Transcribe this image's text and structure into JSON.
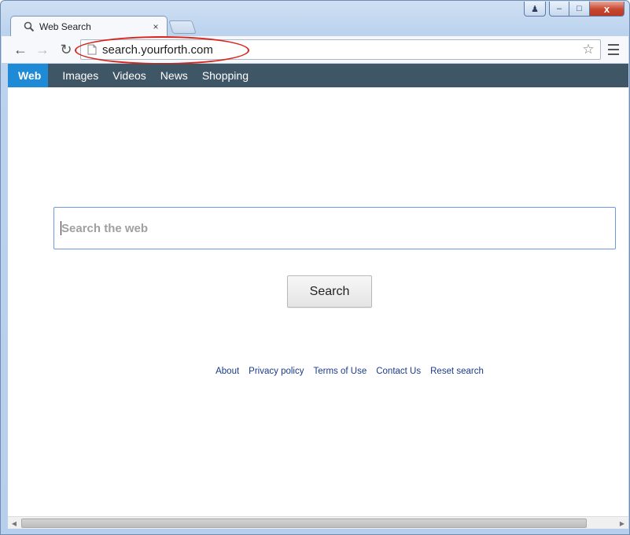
{
  "window": {
    "controls": {
      "user": "♟",
      "minimize": "–",
      "maximize": "□",
      "close": "x"
    }
  },
  "tabs": [
    {
      "title": "Web Search",
      "close": "×"
    }
  ],
  "toolbar": {
    "back": "←",
    "forward": "→",
    "reload": "↻",
    "url": "search.yourforth.com",
    "bookmark_star": "☆"
  },
  "topnav": {
    "items": [
      {
        "label": "Web",
        "active": true
      },
      {
        "label": "Images",
        "active": false
      },
      {
        "label": "Videos",
        "active": false
      },
      {
        "label": "News",
        "active": false
      },
      {
        "label": "Shopping",
        "active": false
      }
    ]
  },
  "search": {
    "placeholder": "Search the web",
    "value": "",
    "button_label": "Search"
  },
  "footer": {
    "links": [
      "About",
      "Privacy policy",
      "Terms of Use",
      "Contact Us",
      "Reset search"
    ]
  },
  "scrollbar": {
    "left_arrow": "◀",
    "right_arrow": "▶"
  },
  "annotation": {
    "color": "#d9241c"
  },
  "colors": {
    "nav_bar": "#3f5666",
    "nav_active": "#1f8bd6",
    "link": "#1a3b8a",
    "search_border": "#6f9ae0"
  }
}
